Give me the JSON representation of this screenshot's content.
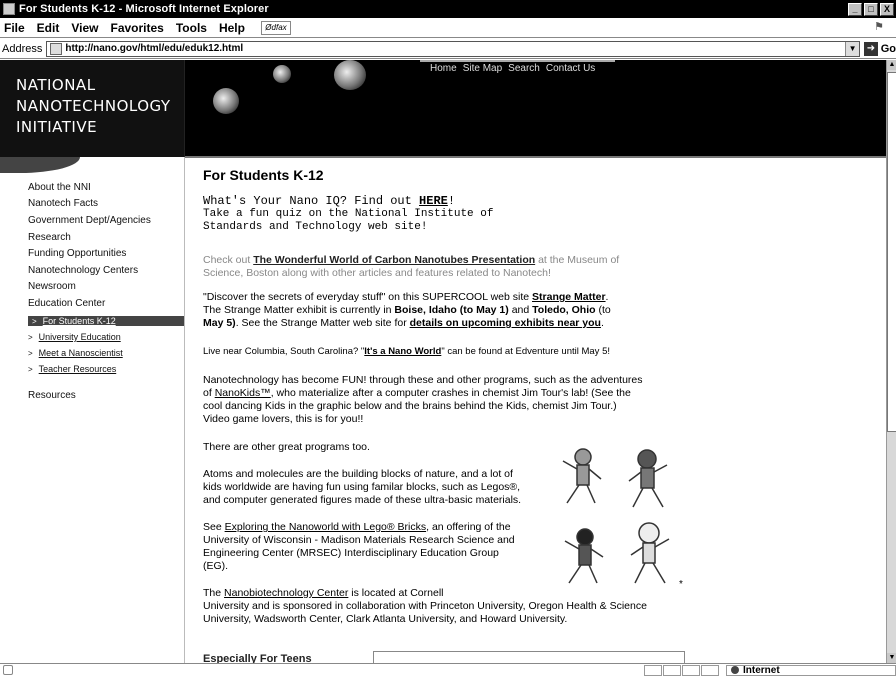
{
  "window": {
    "title": "For Students K-12 - Microsoft Internet Explorer",
    "controls": [
      "_",
      "□",
      "X"
    ]
  },
  "menubar": {
    "items": [
      "File",
      "Edit",
      "View",
      "Favorites",
      "Tools",
      "Help"
    ],
    "toolbar_logo": "Ødfax"
  },
  "addressbar": {
    "label": "Address",
    "url": "http://nano.gov/html/edu/eduk12.html",
    "go_label": "Go"
  },
  "site": {
    "logo_lines": [
      "NATIONAL",
      "NANOTECHNOLOGY",
      "INITIATIVE"
    ],
    "topnav": [
      "Home",
      "Site Map",
      "Search",
      "Contact Us"
    ]
  },
  "sidebar": {
    "items": [
      "About the NNI",
      "Nanotech Facts",
      "Government Dept/Agencies",
      "Research",
      "Funding Opportunities",
      "Nanotechnology Centers",
      "Newsroom",
      "Education Center"
    ],
    "subitems": [
      "For Students K-12",
      "University Education",
      "Meet a Nanoscientist",
      "Teacher Resources"
    ],
    "resources": "Resources"
  },
  "main": {
    "heading": "For Students K-12",
    "quiz": {
      "line1_pre": "What's Your Nano IQ? Find out ",
      "line1_link": "HERE",
      "line1_post": "!",
      "line2": "Take a fun quiz on the National Institute of",
      "line3": "Standards and Technology web site!"
    },
    "museum": {
      "pre": "Check out ",
      "link": "The Wonderful World of Carbon Nanotubes Presentation",
      "post1": " at the Museum of",
      "line2": "Science, Boston along with other articles and features related to Nanotech!"
    },
    "strange": {
      "l1_pre": "\"Discover the secrets of everyday stuff\" on this SUPERCOOL web site ",
      "l1_link": "Strange Matter",
      "l1_post": ".",
      "l2_pre": "The Strange Matter exhibit is currently in ",
      "l2_b1": "Boise, Idaho (to May 1)",
      "l2_mid": " and ",
      "l2_b2": "Toledo, Ohio",
      "l2_post": " (to",
      "l3_b": "May 5)",
      "l3_mid": ". See the Strange Matter web site for ",
      "l3_link": "details on upcoming exhibits near you",
      "l3_post": "."
    },
    "columbia": {
      "pre": "Live near Columbia, South Carolina? \"",
      "link": "It's a Nano World",
      "post": "\" can be found at Edventure until May 5!"
    },
    "fun": {
      "l1": "Nanotechnology has become FUN! through these and other programs, such as the adventures",
      "l2_pre": "of ",
      "l2_link": "NanoKids™",
      "l2_post": ", who materialize after a computer crashes in chemist Jim Tour's lab! (See the",
      "l3": "cool dancing Kids in the graphic below and the brains behind the Kids, chemist Jim Tour.)",
      "l4": "Video game lovers, this is for you!!"
    },
    "other": "There are other great programs too.",
    "atoms": {
      "l1": "Atoms and molecules are the building blocks of nature, and a lot of",
      "l2": "kids worldwide are having fun using familar blocks, such as Legos®,",
      "l3": "and computer generated figures made of these ultra-basic materials."
    },
    "lego": {
      "l1_pre": "See ",
      "l1_link": "Exploring the Nanoworld with Lego® Bricks",
      "l1_post": ", an offering of the",
      "l2": "University of Wisconsin - Madison Materials Research Science and",
      "l3": "Engineering Center (MRSEC) Interdisciplinary Education Group",
      "l4": "(EG)."
    },
    "nanobio": {
      "l1_pre": "The ",
      "l1_link": "Nanobiotechnology Center",
      "l1_post": " is located at Cornell",
      "l2": "University and is sponsored in collaboration with Princeton University, Oregon Health & Science",
      "l3": "University, Wadsworth Center, Clark Atlanta University, and Howard University."
    },
    "teens": "Especially For Teens",
    "asterisk": "*"
  },
  "statusbar": {
    "zone": "Internet"
  },
  "colors": {
    "header_bg": "#000000",
    "active_nav": "#444444"
  }
}
